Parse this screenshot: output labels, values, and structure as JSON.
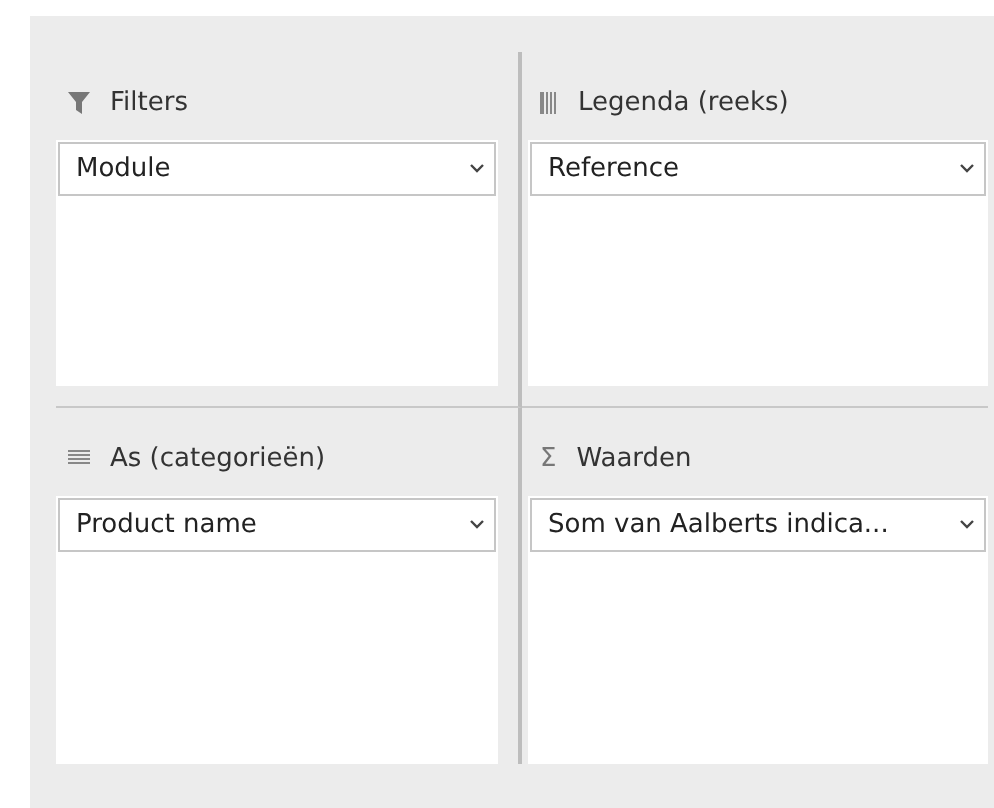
{
  "areas": [
    {
      "kind": "filters",
      "label": "Filters",
      "fields": [
        "Module"
      ]
    },
    {
      "kind": "legend",
      "label": "Legenda (reeks)",
      "fields": [
        "Reference"
      ]
    },
    {
      "kind": "axis",
      "label": "As (categorieën)",
      "fields": [
        "Product name"
      ]
    },
    {
      "kind": "values",
      "label": "Waarden",
      "symbol": "Σ",
      "fields": [
        "Som van Aalberts indica..."
      ]
    }
  ]
}
